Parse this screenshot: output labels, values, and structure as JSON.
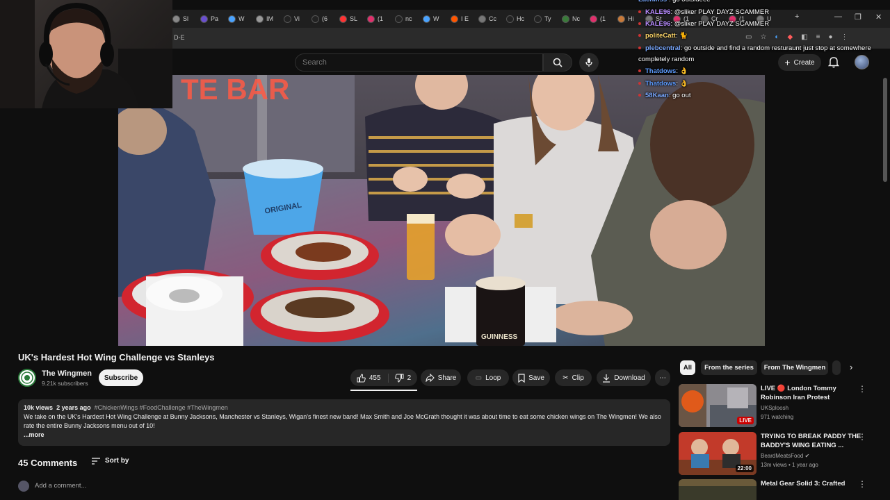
{
  "browser": {
    "tabs": [
      "Sl",
      "Pa",
      "W",
      "IM",
      "Vi",
      "(6",
      "SL",
      "(1",
      "nc",
      "W",
      "I E",
      "Cc",
      "Hc",
      "Ty",
      "Nc",
      "(1",
      "Hi",
      "St",
      "(1",
      "Cr",
      "(1",
      "U"
    ],
    "url_fragment": "D-E",
    "window_controls": [
      "—",
      "❐",
      "✕"
    ]
  },
  "header": {
    "search_placeholder": "Search",
    "create_label": "Create"
  },
  "chat": [
    {
      "user": "KALE96",
      "msg": ": @sliker PLAY DAYZ SCAMMER",
      "color": "#b88cff"
    },
    {
      "user": "KALE96",
      "msg": ": @sliker PLAY DAYZ SCAMMER",
      "color": "#b88cff"
    },
    {
      "user": "politeCatt",
      "msg": ": 🐈",
      "color": "#ffd76a"
    },
    {
      "user": "plebcentral",
      "msg": ": go outside and find a random resturaunt just stop at somewhere",
      "color": "#7aa9ff"
    },
    {
      "user": "",
      "msg": "completely random",
      "color": "#ffffff"
    },
    {
      "user": "Thatdows",
      "msg": ": 👌",
      "color": "#5d9cff"
    },
    {
      "user": "Thatdows",
      "msg": ": 👌",
      "color": "#5d9cff"
    },
    {
      "user": "58Kaan",
      "msg": ": go out",
      "color": "#7aa9ff"
    }
  ],
  "video": {
    "title": "UK's Hardest Hot Wing Challenge vs Stanleys",
    "channel": "The Wingmen",
    "subscribers": "9.21k subscribers",
    "subscribe_label": "Subscribe",
    "likes": "455",
    "dislikes": "2",
    "share": "Share",
    "loop": "Loop",
    "save": "Save",
    "clip": "Clip",
    "download": "Download",
    "sign_text": "TE BAR",
    "bucket_text": "ORIGINAL",
    "glass_text": "GUINNESS"
  },
  "description": {
    "views": "10k views",
    "age": "2 years ago",
    "tags": "#ChickenWings #FoodChallenge #TheWingmen",
    "text": "We take on the UK's Hardest Hot Wing Challenge at Bunny Jacksons, Manchester vs Stanleys, Wigan's finest new band! Max Smith and Joe McGrath thought it was about time to eat some chicken wings on The Wingmen! We also rate the entire Bunny Jacksons menu out of 10!",
    "more": "...more"
  },
  "comments": {
    "count": "45 Comments",
    "sort_by": "Sort by",
    "add_placeholder": "Add a comment..."
  },
  "sidebar": {
    "chips": [
      "All",
      "From the series",
      "From The Wingmen"
    ],
    "recommendations": [
      {
        "title": "LIVE 🔴 London Tommy Robinson Iran Protest",
        "channel": "UKSploosh",
        "meta": "971 watching",
        "badge": "LIVE"
      },
      {
        "title": "TRYING TO BREAK PADDY THE BADDY'S WING EATING ...",
        "channel": "BeardMeatsFood ✔",
        "meta": "13m views • 1 year ago",
        "badge": "22:00"
      },
      {
        "title": "Metal Gear Solid 3: Crafted",
        "channel": "",
        "meta": "",
        "badge": ""
      }
    ]
  },
  "colors": {
    "accent": "#ff0000",
    "background": "#0f0f0f",
    "surface": "#272727"
  }
}
